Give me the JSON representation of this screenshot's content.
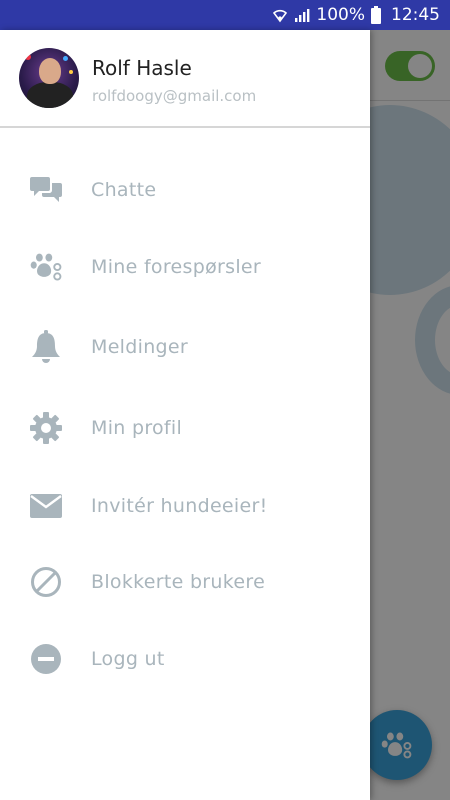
{
  "status_bar": {
    "battery": "100%",
    "time": "12:45"
  },
  "drawer": {
    "user": {
      "name": "Rolf Hasle",
      "email": "rolfdoogy@gmail.com"
    },
    "items": [
      {
        "label": "Chatte",
        "icon": "chat-icon"
      },
      {
        "label": "Mine forespørsler",
        "icon": "paw-icon"
      },
      {
        "label": "Meldinger",
        "icon": "bell-icon"
      },
      {
        "label": "Min profil",
        "icon": "gear-icon"
      },
      {
        "label": "Invitér hundeeier!",
        "icon": "envelope-icon"
      },
      {
        "label": "Blokkerte brukere",
        "icon": "block-icon"
      },
      {
        "label": "Logg ut",
        "icon": "logout-icon"
      }
    ]
  },
  "colors": {
    "status_bar": "#2f39a6",
    "menu_text": "#a9b5bc",
    "toggle": "#6cc04a",
    "fab": "#3ba3dc"
  }
}
